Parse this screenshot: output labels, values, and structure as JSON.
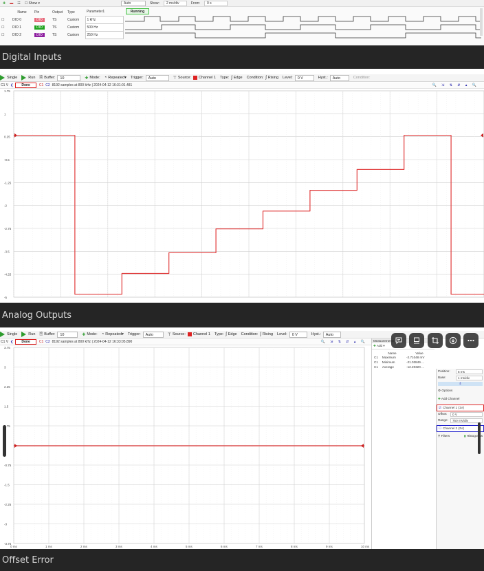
{
  "digital": {
    "toolbar": {
      "mode_value": "Auto",
      "show_label": "Show:",
      "show_value": "2 ms/div",
      "from_label": "From:",
      "from_value": "0 s"
    },
    "table_headers": [
      "Name",
      "Pin",
      "Output",
      "Type",
      "Parameter1"
    ],
    "rows": [
      {
        "name": "DIO 0",
        "pin": "DIO",
        "output": "TS",
        "type": "Custom",
        "param": "1 kHz",
        "pin_color": "#e86a7c"
      },
      {
        "name": "DIO 1",
        "pin": "DIO",
        "output": "TS",
        "type": "Custom",
        "param": "500 Hz",
        "pin_color": "#1fa31f"
      },
      {
        "name": "DIO 2",
        "pin": "DIO",
        "output": "TS",
        "type": "Custom",
        "param": "250 Hz",
        "pin_color": "#8e1fa0"
      }
    ],
    "status": "Running",
    "caption": "Digital Inputs"
  },
  "analog": {
    "toolbar": {
      "single": "Single",
      "run": "Run",
      "buffer_label": "Buffer:",
      "buffer_value": "10",
      "mode_label": "Mode:",
      "mode_value": "Repeated",
      "trigger_label": "Trigger:",
      "trigger_value": "Auto",
      "source_label": "Source:",
      "source_value": "Channel 1",
      "type_label": "Type:",
      "type_value": "Edge",
      "condition_label": "Condition:",
      "condition_value": "Rising",
      "level_label": "Level:",
      "level_value": "0 V",
      "hyst_label": "Hyst.:",
      "hyst_value": "Auto",
      "cond2_label": "Condition:"
    },
    "sub": {
      "ch": "C1 V",
      "status": "Done",
      "c1": "C1",
      "c2": "C2",
      "info": "8192 samples at 800 kHz  |  2024-04-12 16:31:01.481"
    },
    "yticks": [
      "1.75",
      "1",
      "0.25",
      "-0.5",
      "-1.25",
      "-2",
      "-2.75",
      "-3.5",
      "-4.25",
      "-5"
    ],
    "caption": "Analog Outputs",
    "chart_data": {
      "type": "line",
      "title": "",
      "xlabel": "",
      "ylabel": "C1 V",
      "ylim": [
        -5.2,
        1.75
      ],
      "series": [
        {
          "points": [
            [
              0,
              0.25
            ],
            [
              1.3,
              0.25
            ],
            [
              1.3,
              -5.1
            ],
            [
              2.3,
              -5.1
            ],
            [
              2.3,
              -4.4
            ],
            [
              3.3,
              -4.4
            ],
            [
              3.3,
              -3.7
            ],
            [
              4.3,
              -3.7
            ],
            [
              4.3,
              -2.9
            ],
            [
              5.3,
              -2.9
            ],
            [
              5.3,
              -2.3
            ],
            [
              6.3,
              -2.3
            ],
            [
              6.3,
              -1.6
            ],
            [
              7.3,
              -1.6
            ],
            [
              7.3,
              -0.9
            ],
            [
              8.3,
              -0.9
            ],
            [
              8.3,
              0.25
            ],
            [
              9.3,
              0.25
            ],
            [
              9.3,
              -5.1
            ],
            [
              10,
              -5.1
            ]
          ]
        }
      ]
    }
  },
  "offset": {
    "toolbar": {
      "single": "Single",
      "run": "Run",
      "buffer_label": "Buffer:",
      "buffer_value": "10",
      "mode_label": "Mode:",
      "mode_value": "Repeated",
      "trigger_label": "Trigger:",
      "trigger_value": "Auto",
      "source_label": "Source:",
      "source_value": "Channel 1",
      "type_label": "Type:",
      "type_value": "Edge",
      "condition_label": "Condition:",
      "condition_value": "Rising",
      "level_label": "Level:",
      "level_value": "0 V",
      "hyst_label": "Hyst.:",
      "hyst_value": "Auto"
    },
    "sub": {
      "ch": "C1 V",
      "status": "Done",
      "c1": "C1",
      "c2": "C2",
      "info": "8192 samples at 800 kHz  |  2024-04-12 16:33:05.890"
    },
    "yticks": [
      "3.75",
      "3",
      "2.25",
      "1.5",
      "0.75",
      "0",
      "-0.75",
      "-1.5",
      "-2.25",
      "-3",
      "-3.75"
    ],
    "xticks": [
      "0 ms",
      "1 ms",
      "2 ms",
      "3 ms",
      "4 ms",
      "5 ms",
      "6 ms",
      "7 ms",
      "8 ms",
      "9 ms",
      "10 ms"
    ],
    "measurements": {
      "title": "Measurements",
      "add": "Add",
      "headers": [
        "Name",
        "Value"
      ],
      "rows": [
        {
          "ch": "C1",
          "name": "Maximum",
          "value": "-2.71048 mV"
        },
        {
          "ch": "C1",
          "name": "Minimum",
          "value": "-21.03849 ..."
        },
        {
          "ch": "C1",
          "name": "Average",
          "value": "-12.20320 ..."
        }
      ]
    },
    "side_panel": {
      "position_label": "Position:",
      "position_value": "5 ms",
      "base_label": "Base:",
      "base_value": "1 ms/div",
      "options": "Options",
      "add_channel": "Add Channel",
      "ch1": "Channel 1 (1V)",
      "offset_label": "Offset:",
      "offset_value": "0 V",
      "range_label": "Range:",
      "range_value": "750 mV/div",
      "ch2": "Channel 2 (2V)",
      "filters": "Filters",
      "histograms": "Histograms"
    },
    "caption": "Offset Error",
    "chart_data": {
      "type": "line",
      "title": "",
      "xlabel": "",
      "ylabel": "C1 V",
      "ylim": [
        -3.75,
        3.75
      ],
      "xlim": [
        0,
        10
      ],
      "series": [
        {
          "points": [
            [
              0,
              -0.012
            ],
            [
              10,
              -0.012
            ]
          ]
        }
      ]
    },
    "overlay_icons": [
      "comment-icon",
      "screen-icon",
      "crop-icon",
      "download-icon",
      "more-icon"
    ]
  }
}
